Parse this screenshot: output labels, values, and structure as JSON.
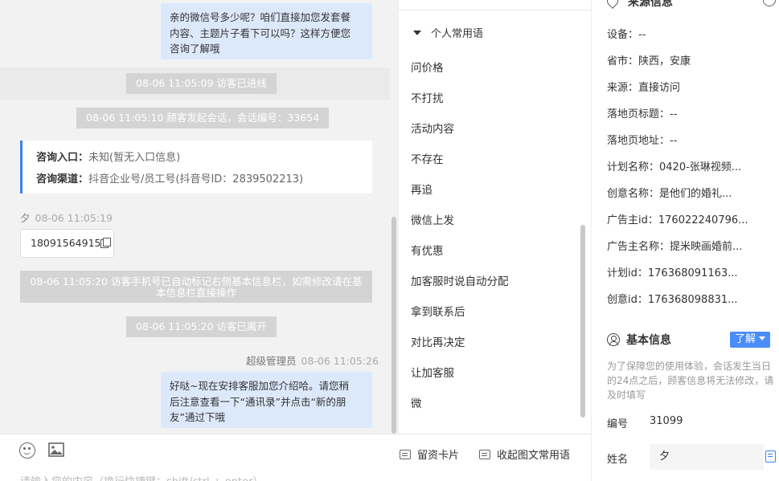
{
  "chat": {
    "bubble_top": {
      "lines": [
        "亲的微信号多少呢？咱们直接加您发套餐",
        "内容、主题片子看下可以吗？这样方便您",
        "咨询了解哦"
      ]
    },
    "system_messages": {
      "visitor_joined": "08-06 11:05:09 访客已进线",
      "session_started": "08-06 11:05:10 顾客发起会话，会话编号：33654",
      "visitor_left": "08-06 11:05:20 访客已离开"
    },
    "info_card": {
      "entry_label": "咨询入口：",
      "entry_value": "未知(暂无入口信息)",
      "channel_label": "咨询渠道：",
      "channel_value": "抖音企业号/员工号(抖音号ID：2839502213)"
    },
    "visitor": {
      "name": "夕",
      "time": "08-06 11:05:19",
      "phone": "18091564915"
    },
    "auto_notice": {
      "line1": "08-06 11:05:20 访客手机号已自动标记右侧基本信息栏，如需修改请在基",
      "line2": "本信息栏直接操作"
    },
    "agent": {
      "name": "超级管理员",
      "time": "08-06 11:05:26"
    },
    "bubble_bottom": {
      "lines": [
        "好哒~现在安排客服加您介绍哈。请您稍",
        "后注意查看一下“通讯录”并点击“新的朋",
        "友”通过下哦"
      ]
    }
  },
  "input_bar": {
    "placeholder": "请输入您的内容（换行快捷键：shift/ctrl + enter）",
    "emoji_icon": "smile-icon",
    "image_icon": "image-icon",
    "card_button": "留资卡片",
    "collect_button": "收起图文常用语"
  },
  "phrases": {
    "header": "个人常用语",
    "items": [
      "问价格",
      "不打扰",
      "活动内容",
      "不存在",
      "再追",
      "微信上发",
      "有优惠",
      "加客服时说自动分配",
      "拿到联系后",
      "对比再决定",
      "让加客服",
      "微"
    ]
  },
  "source_info": {
    "title": "来源信息",
    "rows": [
      {
        "label": "设备：",
        "value": "--"
      },
      {
        "label": "省市：",
        "value": "陕西，安康"
      },
      {
        "label": "来源：",
        "value": "直接访问"
      },
      {
        "label": "落地页标题：",
        "value": "--"
      },
      {
        "label": "落地页地址：",
        "value": "--"
      },
      {
        "label": "计划名称：",
        "value": "0420-张琳视频..."
      },
      {
        "label": "创意名称：",
        "value": "是他们的婚礼..."
      },
      {
        "label": "广告主id：",
        "value": "176022240796..."
      },
      {
        "label": "广告主名称：",
        "value": "提米映画婚前..."
      },
      {
        "label": "计划id：",
        "value": "176368091163..."
      },
      {
        "label": "创意id：",
        "value": "176368098831..."
      }
    ]
  },
  "basic_info": {
    "title": "基本信息",
    "learn_button": "了解",
    "hint": "为了保障您的使用体验，会话发生当日的24点之后，顾客信息将无法修改，请及时填写",
    "id_label": "编号",
    "id_value": "31099",
    "name_label": "姓名",
    "name_value": "夕"
  },
  "colors": {
    "accent": "#4a8df8",
    "bubble": "#dce9fb",
    "system_pill": "#d4d4d4",
    "chat_bg": "#f2f2f2"
  }
}
